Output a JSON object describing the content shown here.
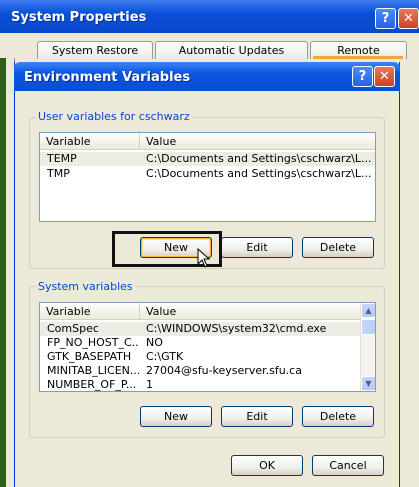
{
  "system_properties": {
    "title": "System Properties",
    "tabs": [
      "System Restore",
      "Automatic Updates",
      "Remote"
    ]
  },
  "env_dialog": {
    "title": "Environment Variables",
    "user_group_label": "User variables for cschwarz",
    "system_group_label": "System variables",
    "columns": [
      "Variable",
      "Value"
    ],
    "user_vars": [
      {
        "variable": "TEMP",
        "value": "C:\\Documents and Settings\\cschwarz\\L..."
      },
      {
        "variable": "TMP",
        "value": "C:\\Documents and Settings\\cschwarz\\L..."
      }
    ],
    "system_vars": [
      {
        "variable": "ComSpec",
        "value": "C:\\WINDOWS\\system32\\cmd.exe"
      },
      {
        "variable": "FP_NO_HOST_C...",
        "value": "NO"
      },
      {
        "variable": "GTK_BASEPATH",
        "value": "C:\\GTK"
      },
      {
        "variable": "MINITAB_LICEN...",
        "value": "27004@sfu-keyserver.sfu.ca"
      },
      {
        "variable": "NUMBER_OF_P...",
        "value": "1"
      }
    ],
    "user_buttons": {
      "new": "New",
      "edit": "Edit",
      "delete": "Delete"
    },
    "system_buttons": {
      "new": "New",
      "edit": "Edit",
      "delete": "Delete"
    },
    "ok": "OK",
    "cancel": "Cancel",
    "help_glyph": "?",
    "close_glyph": "✕"
  },
  "icons": {
    "help": "help-icon",
    "close": "close-icon",
    "scroll_up": "▲",
    "scroll_down": "▼",
    "cursor": "mouse-cursor-icon"
  },
  "colors": {
    "titlebar_blue": "#0a4fd8",
    "group_label_blue": "#0046d5",
    "dialog_bg": "#ece9d8"
  }
}
